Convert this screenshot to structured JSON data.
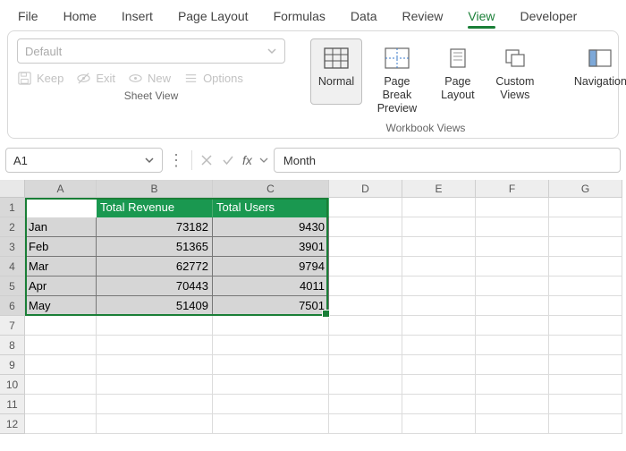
{
  "tabs": [
    "File",
    "Home",
    "Insert",
    "Page Layout",
    "Formulas",
    "Data",
    "Review",
    "View",
    "Developer"
  ],
  "active_tab": "View",
  "sheetview": {
    "combo_placeholder": "Default",
    "keep": "Keep",
    "exit": "Exit",
    "new": "New",
    "options": "Options",
    "group_label": "Sheet View"
  },
  "wbviews": {
    "normal": "Normal",
    "pagebreak": "Page Break Preview",
    "pagelayout": "Page Layout",
    "custom": "Custom Views",
    "group_label": "Workbook Views"
  },
  "navigation": "Navigation",
  "namebox": "A1",
  "fx_value": "Month",
  "columns": [
    "A",
    "B",
    "C",
    "D",
    "E",
    "F",
    "G"
  ],
  "row_numbers": [
    "1",
    "2",
    "3",
    "4",
    "5",
    "6",
    "7",
    "8",
    "9",
    "10",
    "11",
    "12"
  ],
  "sheet": {
    "headers": [
      "Month",
      "Total Revenue",
      "Total Users"
    ],
    "rows": [
      {
        "m": "Jan",
        "r": "73182",
        "u": "9430"
      },
      {
        "m": "Feb",
        "r": "51365",
        "u": "3901"
      },
      {
        "m": "Mar",
        "r": "62772",
        "u": "9794"
      },
      {
        "m": "Apr",
        "r": "70443",
        "u": "4011"
      },
      {
        "m": "May",
        "r": "51409",
        "u": "7501"
      }
    ]
  }
}
